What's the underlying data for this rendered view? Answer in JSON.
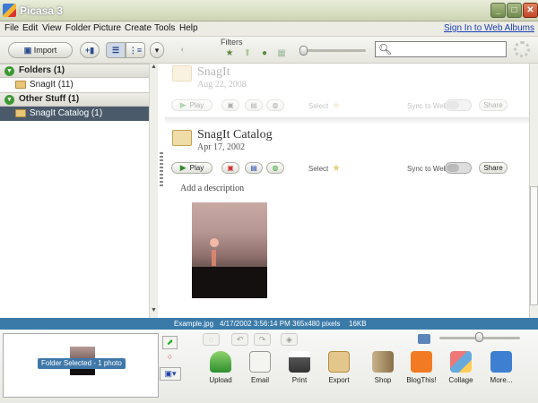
{
  "window": {
    "title": "Picasa 3"
  },
  "menu": [
    "File",
    "Edit",
    "View",
    "Folder",
    "Picture",
    "Create",
    "Tools",
    "Help"
  ],
  "sign_in": "Sign In to Web Albums",
  "toolbar": {
    "import_label": "Import",
    "filters_label": "Filters",
    "search_placeholder": ""
  },
  "left_panel": {
    "sections": [
      {
        "label": "Folders (1)",
        "items": [
          {
            "label": "SnagIt (11)",
            "selected": false
          }
        ]
      },
      {
        "label": "Other Stuff (1)",
        "items": [
          {
            "label": "SnagIt Catalog (1)",
            "selected": true
          }
        ]
      }
    ]
  },
  "folders": [
    {
      "name": "SnagIt",
      "date": "Aug 22, 2008",
      "faded": true
    },
    {
      "name": "SnagIt Catalog",
      "date": "Apr 17, 2002",
      "faded": false
    }
  ],
  "card_controls": {
    "play": "Play",
    "select": "Select",
    "sync": "Sync to Web",
    "share": "Share"
  },
  "description_placeholder": "Add a description",
  "status": {
    "filename": "Example.jpg",
    "datetime": "4/17/2002 3:56:14 PM",
    "dimensions": "365x480 pixels",
    "size": "16KB"
  },
  "tray": {
    "selection_label": "Folder Selected - 1 photo"
  },
  "actions": [
    "Upload",
    "Email",
    "Print",
    "Export",
    "Shop",
    "BlogThis!",
    "Collage",
    "More..."
  ],
  "colors": {
    "status_bar": "#3a7aa9",
    "selected_row": "#4b5a6b",
    "blogger": "#f27a22",
    "more": "#3f7fd1"
  }
}
